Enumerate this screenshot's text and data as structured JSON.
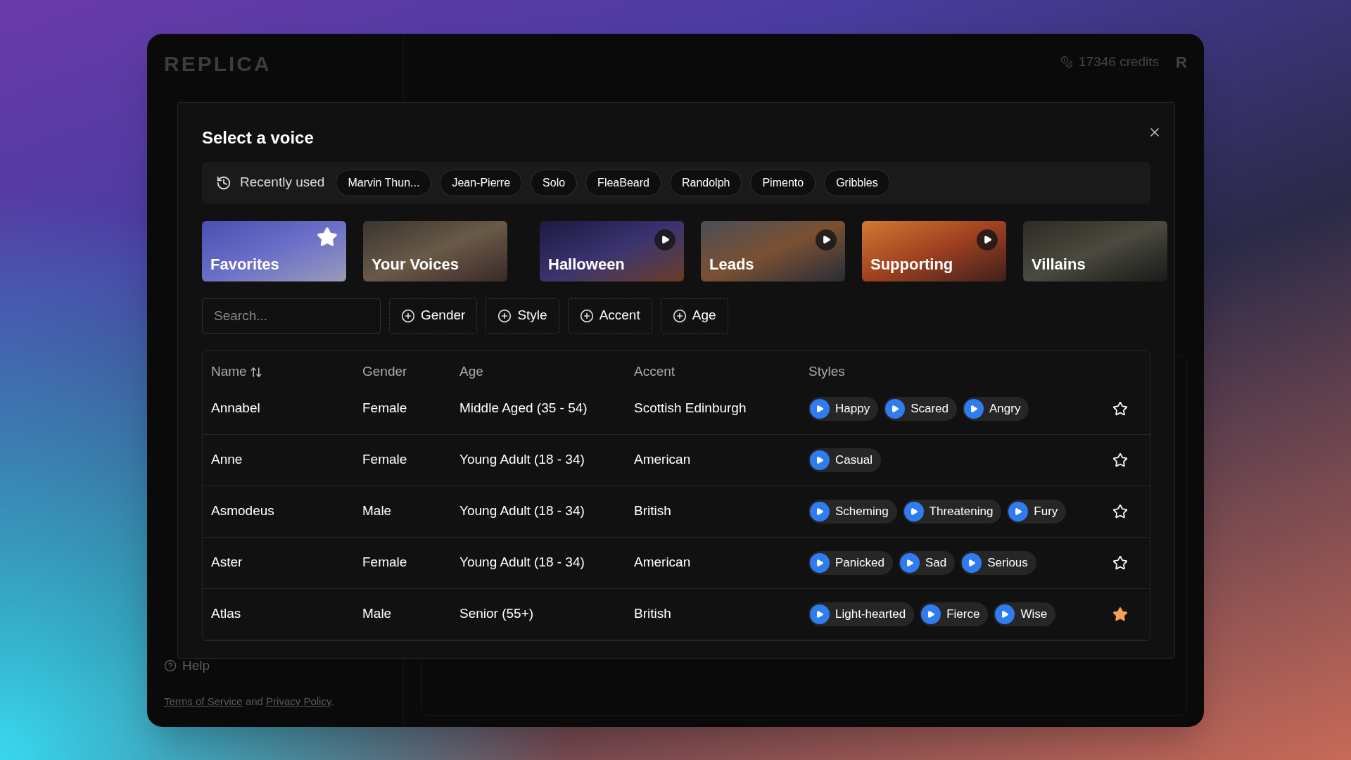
{
  "app": {
    "logo": "REPLICA",
    "credits": "17346 credits",
    "avatar": "R",
    "help": "Help",
    "footer": {
      "terms": "Terms of Service",
      "and": "and",
      "privacy": "Privacy Policy",
      "end": "."
    }
  },
  "dialog": {
    "title": "Select a voice",
    "recent": {
      "label": "Recently used",
      "items": [
        "Marvin Thun...",
        "Jean-Pierre",
        "Solo",
        "FleaBeard",
        "Randolph",
        "Pimento",
        "Gribbles"
      ]
    },
    "categories": [
      {
        "label": "Favorites",
        "kind": "favorites"
      },
      {
        "label": "Your Voices",
        "kind": "plain"
      },
      {
        "label": "Halloween",
        "kind": "playable"
      },
      {
        "label": "Leads",
        "kind": "playable"
      },
      {
        "label": "Supporting",
        "kind": "playable"
      },
      {
        "label": "Villains",
        "kind": "plain"
      }
    ],
    "search": {
      "placeholder": "Search..."
    },
    "filters": [
      "Gender",
      "Style",
      "Accent",
      "Age"
    ],
    "table": {
      "columns": [
        "Name",
        "Gender",
        "Age",
        "Accent",
        "Styles"
      ],
      "rows": [
        {
          "name": "Annabel",
          "gender": "Female",
          "age": "Middle Aged (35 - 54)",
          "accent": "Scottish Edinburgh",
          "styles": [
            "Happy",
            "Scared",
            "Angry"
          ],
          "favorite": false
        },
        {
          "name": "Anne",
          "gender": "Female",
          "age": "Young Adult (18 - 34)",
          "accent": "American",
          "styles": [
            "Casual"
          ],
          "favorite": false
        },
        {
          "name": "Asmodeus",
          "gender": "Male",
          "age": "Young Adult (18 - 34)",
          "accent": "British",
          "styles": [
            "Scheming",
            "Threatening",
            "Fury"
          ],
          "favorite": false
        },
        {
          "name": "Aster",
          "gender": "Female",
          "age": "Young Adult (18 - 34)",
          "accent": "American",
          "styles": [
            "Panicked",
            "Sad",
            "Serious"
          ],
          "favorite": false
        },
        {
          "name": "Atlas",
          "gender": "Male",
          "age": "Senior (55+)",
          "accent": "British",
          "styles": [
            "Light-hearted",
            "Fierce",
            "Wise"
          ],
          "favorite": true
        }
      ]
    }
  }
}
